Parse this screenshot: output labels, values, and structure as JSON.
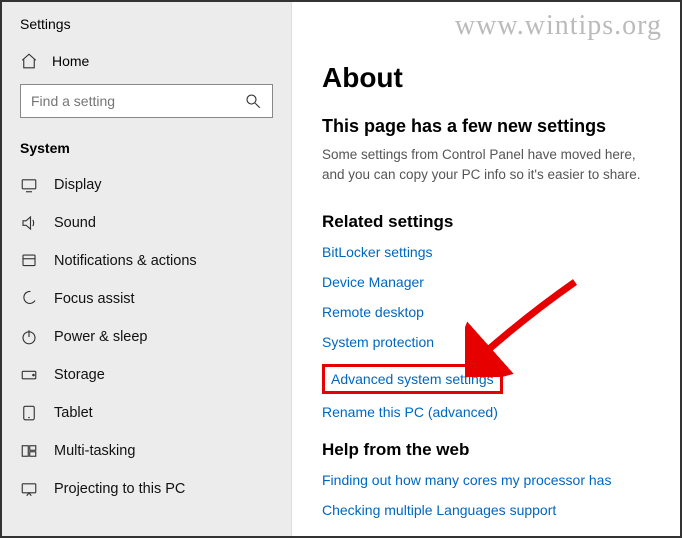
{
  "watermark": "www.wintips.org",
  "sidebar": {
    "header": "Settings",
    "home": "Home",
    "search_placeholder": "Find a setting",
    "category": "System",
    "items": [
      {
        "icon": "display-icon",
        "label": "Display"
      },
      {
        "icon": "sound-icon",
        "label": "Sound"
      },
      {
        "icon": "notifications-icon",
        "label": "Notifications & actions"
      },
      {
        "icon": "focus-icon",
        "label": "Focus assist"
      },
      {
        "icon": "power-icon",
        "label": "Power & sleep"
      },
      {
        "icon": "storage-icon",
        "label": "Storage"
      },
      {
        "icon": "tablet-icon",
        "label": "Tablet"
      },
      {
        "icon": "multitasking-icon",
        "label": "Multi-tasking"
      },
      {
        "icon": "projecting-icon",
        "label": "Projecting to this PC"
      }
    ]
  },
  "content": {
    "title": "About",
    "new_settings_heading": "This page has a few new settings",
    "new_settings_desc": "Some settings from Control Panel have moved here, and you can copy your PC info so it's easier to share.",
    "related_heading": "Related settings",
    "related_links": [
      "BitLocker settings",
      "Device Manager",
      "Remote desktop",
      "System protection",
      "Advanced system settings",
      "Rename this PC (advanced)"
    ],
    "highlighted_index": 4,
    "help_heading": "Help from the web",
    "help_links": [
      "Finding out how many cores my processor has",
      "Checking multiple Languages support"
    ]
  }
}
